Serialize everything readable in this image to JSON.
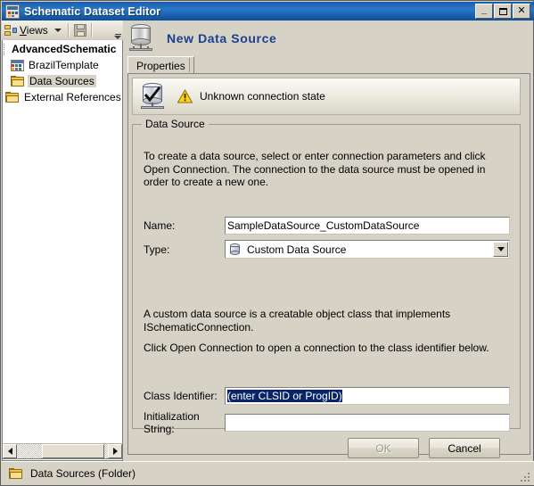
{
  "window": {
    "title": "Schematic Dataset Editor",
    "icon": "schematic-dataset-icon",
    "buttons": {
      "minimize": "_",
      "maximize": "□",
      "close": "✕"
    }
  },
  "toolbar": {
    "views_label": "Views",
    "views_accesskey": "V",
    "views_icon": "views-icon",
    "dropdown_icon": "chevron-down-icon",
    "save_icon": "save-icon",
    "overflow_icon": "toolbar-overflow-icon"
  },
  "tree": {
    "items": [
      {
        "label": "AdvancedSchematic",
        "icon": "schematic-icon",
        "level": 0,
        "bold": true,
        "selected": false
      },
      {
        "label": "BrazilTemplate",
        "icon": "schematic-icon",
        "level": 1,
        "bold": false,
        "selected": false
      },
      {
        "label": "Data Sources",
        "icon": "folder-icon",
        "level": 1,
        "bold": false,
        "selected": true
      },
      {
        "label": "External References",
        "icon": "folder-icon",
        "level": 1,
        "bold": false,
        "selected": false
      }
    ],
    "scrollbar": {
      "left_arrow": "scroll-left-arrow",
      "right_arrow": "scroll-right-arrow"
    }
  },
  "header": {
    "title": "New Data Source",
    "icon": "database-icon"
  },
  "tabs": [
    {
      "label": "Properties",
      "active": true
    }
  ],
  "connection_status": {
    "icon": "database-checked-icon",
    "warning_icon": "warning-triangle-icon",
    "text": "Unknown connection state"
  },
  "groupbox": {
    "legend": "Data Source",
    "intro_paragraph": "To create a data source, select or enter connection parameters and click Open Connection.  The connection to the data source must be opened in order to create a new one.",
    "fields": {
      "name": {
        "label": "Name:",
        "value": "SampleDataSource_CustomDataSource",
        "placeholder": ""
      },
      "type": {
        "label": "Type:",
        "value": "Custom Data Source",
        "icon": "database-small-icon",
        "dropdown_icon": "chevron-down-icon",
        "options": [
          "Custom Data Source"
        ]
      },
      "class_identifier": {
        "label": "Class Identifier:",
        "value": "(enter CLSID or ProgID)",
        "selected": true
      },
      "initialization_string": {
        "label": "Initialization String:",
        "value": "",
        "placeholder": ""
      }
    },
    "description_paragraph_1": "A custom data source is a creatable object class that implements ISchematicConnection.",
    "description_paragraph_2": "Click Open Connection to open a connection to the class identifier below."
  },
  "buttons": {
    "ok": {
      "label": "OK",
      "enabled": false
    },
    "cancel": {
      "label": "Cancel",
      "enabled": true
    }
  },
  "statusbar": {
    "icon": "folder-icon",
    "text": "Data Sources (Folder)",
    "grip": "resize-grip"
  },
  "colors": {
    "title_bar_start": "#1b5ca8",
    "title_bar_end": "#0f4f96",
    "face": "#d6d2c6",
    "header_title": "#1b3f8f",
    "selection": "#0a246a",
    "warning": "#ffcc00"
  }
}
